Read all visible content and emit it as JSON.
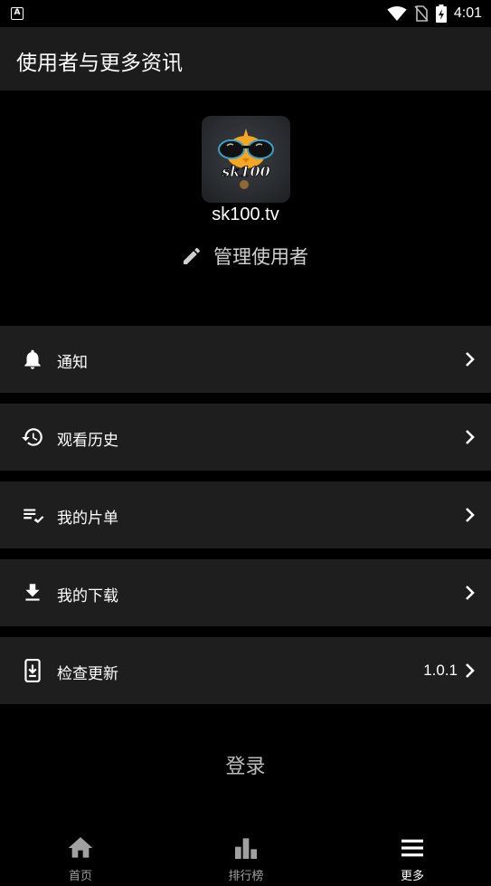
{
  "status_bar": {
    "left_icon_letter": "A",
    "time": "4:01",
    "icons": [
      "wifi-icon",
      "sim-off-icon",
      "battery-charging-icon"
    ]
  },
  "header": {
    "title": "使用者与更多资讯"
  },
  "profile": {
    "avatar_text": "sk100",
    "username": "sk100.tv",
    "manage_label": "管理使用者",
    "manage_icon": "pencil-icon"
  },
  "menu": {
    "items": [
      {
        "label": "通知",
        "icon": "bell-icon"
      },
      {
        "label": "观看历史",
        "icon": "history-icon"
      },
      {
        "label": "我的片单",
        "icon": "playlist-check-icon"
      },
      {
        "label": "我的下载",
        "icon": "download-icon"
      },
      {
        "label": "检查更新",
        "icon": "phone-update-icon",
        "value": "1.0.1"
      }
    ]
  },
  "login_label": "登录",
  "bottom_nav": {
    "items": [
      {
        "label": "首页",
        "icon": "home-icon",
        "active": false
      },
      {
        "label": "排行榜",
        "icon": "bar-chart-icon",
        "active": false
      },
      {
        "label": "更多",
        "icon": "menu-icon",
        "active": true
      }
    ]
  },
  "colors": {
    "background": "#000000",
    "surface": "#1e1e1e",
    "app_bar": "#1c1c1c",
    "text_primary": "#ffffff",
    "text_secondary": "#bdbdbd",
    "nav_inactive": "#a0a0a0"
  }
}
